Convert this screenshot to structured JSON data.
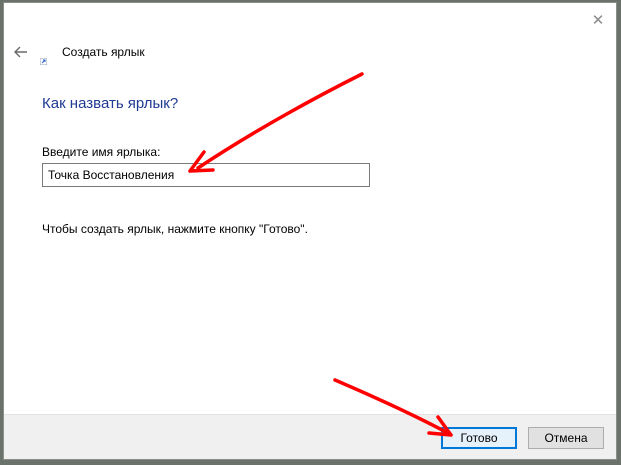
{
  "window": {
    "title": "Создать ярлык",
    "close_glyph": "✕",
    "icons": {
      "back": "back-arrow-icon",
      "close": "close-icon",
      "app": "shortcut-icon"
    }
  },
  "main": {
    "heading": "Как назвать ярлык?",
    "field_label": "Введите имя ярлыка:",
    "field_value": "Точка Восстановления",
    "hint": "Чтобы создать ярлык, нажмите кнопку \"Готово\"."
  },
  "footer": {
    "finish_label": "Готово",
    "cancel_label": "Отмена"
  },
  "colors": {
    "heading": "#1f3a93",
    "accent": "#0078d7",
    "annotation_arrow": "#ff0000"
  }
}
